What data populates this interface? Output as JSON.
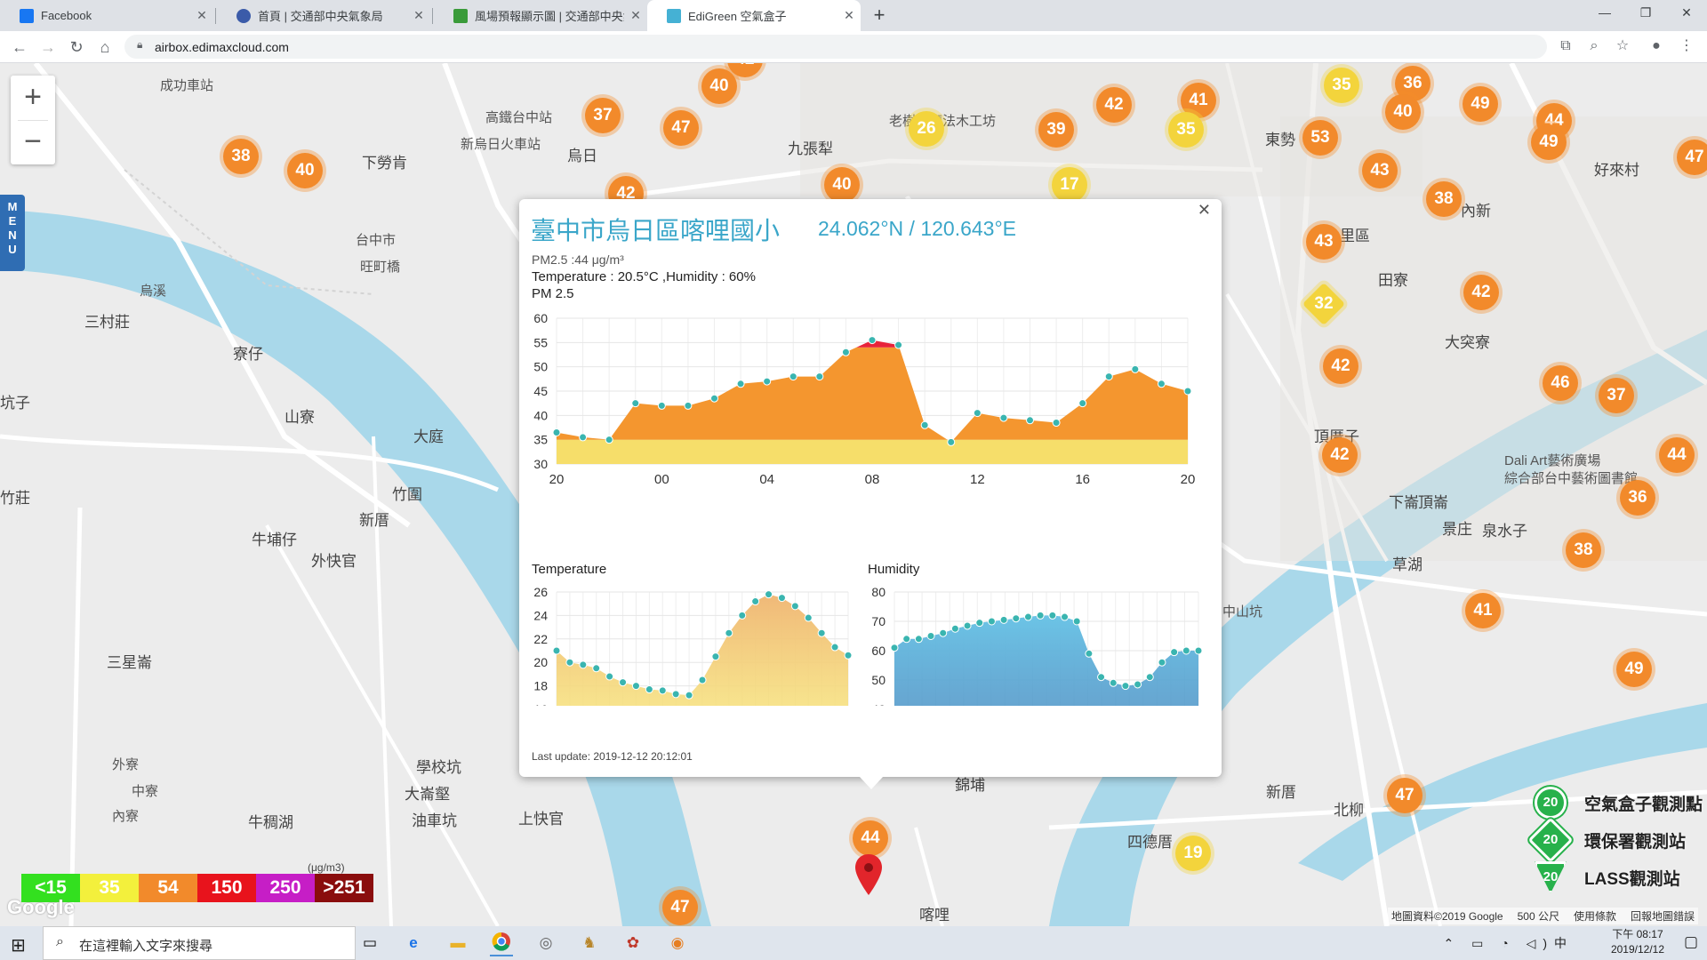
{
  "browser": {
    "tabs": [
      {
        "title": "Facebook",
        "favicon_color": "#1877f2",
        "active": false
      },
      {
        "title": "首頁 | 交通部中央氣象局",
        "favicon_color": "#3b5ba9",
        "active": false
      },
      {
        "title": "風場預報顯示圖 | 交通部中央氣象局",
        "favicon_color": "#3a9b3a",
        "active": false
      },
      {
        "title": "EdiGreen 空氣盒子",
        "favicon_color": "#45b1d4",
        "active": true
      }
    ],
    "new_tab": "+",
    "url": "airbox.edimaxcloud.com",
    "window_controls": [
      "—",
      "❐",
      "✕"
    ]
  },
  "map": {
    "zoom_in": "+",
    "zoom_out": "−",
    "menu_label": [
      "M",
      "E",
      "N",
      "U"
    ],
    "markers": [
      {
        "value": "38",
        "color": "orange"
      },
      {
        "value": "40",
        "color": "orange"
      },
      {
        "value": "37",
        "color": "orange"
      },
      {
        "value": "47",
        "color": "orange"
      },
      {
        "value": "40",
        "color": "orange"
      },
      {
        "value": "42",
        "color": "orange"
      },
      {
        "value": "26",
        "color": "yellow"
      },
      {
        "value": "39",
        "color": "orange"
      },
      {
        "value": "40",
        "color": "orange"
      },
      {
        "value": "42",
        "color": "orange"
      },
      {
        "value": "17",
        "color": "yellow"
      },
      {
        "value": "42",
        "color": "orange"
      },
      {
        "value": "41",
        "color": "orange"
      },
      {
        "value": "35",
        "color": "yellow"
      },
      {
        "value": "35",
        "color": "yellow"
      },
      {
        "value": "36",
        "color": "orange"
      },
      {
        "value": "40",
        "color": "orange"
      },
      {
        "value": "49",
        "color": "orange"
      },
      {
        "value": "44",
        "color": "orange"
      },
      {
        "value": "53",
        "color": "orange"
      },
      {
        "value": "43",
        "color": "orange"
      },
      {
        "value": "49",
        "color": "orange"
      },
      {
        "value": "38",
        "color": "orange"
      },
      {
        "value": "43",
        "color": "orange"
      },
      {
        "value": "32",
        "color": "yellow"
      },
      {
        "value": "42",
        "color": "orange"
      },
      {
        "value": "42",
        "color": "orange"
      },
      {
        "value": "46",
        "color": "orange"
      },
      {
        "value": "37",
        "color": "orange"
      },
      {
        "value": "42",
        "color": "orange"
      },
      {
        "value": "44",
        "color": "orange"
      },
      {
        "value": "36",
        "color": "orange"
      },
      {
        "value": "38",
        "color": "orange"
      },
      {
        "value": "41",
        "color": "orange"
      },
      {
        "value": "49",
        "color": "orange"
      },
      {
        "value": "47",
        "color": "orange"
      },
      {
        "value": "19",
        "color": "yellow"
      },
      {
        "value": "44",
        "color": "orange"
      },
      {
        "value": "47",
        "color": "orange"
      },
      {
        "value": "47",
        "color": "orange"
      }
    ],
    "labels": [
      "成功車站",
      "高鐵台中站",
      "新烏日火車站",
      "烏日",
      "下勞肯",
      "九張犁",
      "老樹根魔法木工坊",
      "台中市",
      "旺町橋",
      "烏溪",
      "三村莊",
      "寮仔",
      "山寮",
      "大庭",
      "竹圍",
      "新厝",
      "牛埔仔",
      "外快官",
      "三星崙",
      "學校坑",
      "大崙壑",
      "油車坑",
      "上快官",
      "牛稠湖",
      "外寮",
      "中寮",
      "內寮",
      "坑子",
      "竹莊",
      "東勢",
      "大里區",
      "田寮",
      "大突寮",
      "頂厝子",
      "頂崙",
      "景庄",
      "泉水子",
      "草湖",
      "內新",
      "好來村",
      "北柳",
      "四德厝",
      "新厝",
      "下崙",
      "喀哩",
      "錦埔",
      "中山坑",
      "Dali Art藝術廣場",
      "綜合部台中藝術圖書館"
    ],
    "legend": [
      {
        "label": "<15",
        "color": "#33e01f"
      },
      {
        "label": "35",
        "color": "#f3f03c"
      },
      {
        "label": "54",
        "color": "#f28a2b"
      },
      {
        "label": "150",
        "color": "#e8131c"
      },
      {
        "label": "250",
        "color": "#c61ec6"
      },
      {
        "label": ">251",
        "color": "#8a0d0d"
      }
    ],
    "legend_unit": "(μg/m3)",
    "google": "Google",
    "station_types": [
      {
        "badge": "20",
        "label": "空氣盒子觀測點"
      },
      {
        "badge": "20",
        "label": "環保署觀測站"
      },
      {
        "badge": "20",
        "label": "LASS觀測站"
      }
    ],
    "attribution": [
      "地圖資料©2019 Google",
      "500 公尺",
      "使用條款",
      "回報地圖錯誤"
    ]
  },
  "popup": {
    "close": "✕",
    "site_name": "臺中市烏日區喀哩國小",
    "coords": "24.062°N / 120.643°E",
    "pm25_line": "PM2.5 :44 μg/m³",
    "temp_hum_line": "Temperature : 20.5°C ,Humidity : 60%",
    "chart_title": "PM 2.5",
    "temp_title": "Temperature",
    "hum_title": "Humidity",
    "last_update": "Last update: 2019-12-12 20:12:01"
  },
  "chart_data": [
    {
      "type": "area",
      "title": "PM 2.5",
      "x_ticks": [
        "20",
        "00",
        "04",
        "08",
        "12",
        "16",
        "20"
      ],
      "ylim": [
        30,
        60
      ],
      "y_ticks": [
        30,
        35,
        40,
        45,
        50,
        55,
        60
      ],
      "series": [
        {
          "values": [
            36.5,
            35.5,
            35,
            42.5,
            42,
            42,
            43.5,
            46.5,
            47,
            48,
            48,
            53,
            55.5,
            54.5,
            38,
            34.5,
            40.5,
            39.5,
            39,
            38.5,
            42.5,
            48,
            49.5,
            46.5,
            45
          ]
        }
      ],
      "colors": {
        "low": "#f6de6a",
        "mid": "#f4962f",
        "high": "#e8233a"
      },
      "grid": true
    },
    {
      "type": "area",
      "title": "Temperature",
      "ylim": [
        16,
        26
      ],
      "y_ticks": [
        16,
        18,
        20,
        22,
        24,
        26
      ],
      "series": [
        {
          "values": [
            21,
            20,
            19.8,
            19.5,
            18.8,
            18.3,
            18,
            17.7,
            17.6,
            17.3,
            17.2,
            18.5,
            20.5,
            22.5,
            24,
            25.2,
            25.8,
            25.5,
            24.8,
            23.8,
            22.5,
            21.3,
            20.6
          ]
        }
      ],
      "colors": {
        "fill": "#f0c070",
        "point": "#3ab5b0"
      },
      "grid": true
    },
    {
      "type": "area",
      "title": "Humidity",
      "ylim": [
        40,
        80
      ],
      "y_ticks": [
        40,
        50,
        60,
        70,
        80
      ],
      "series": [
        {
          "values": [
            61,
            64,
            64,
            65,
            66,
            67.5,
            68.5,
            69.5,
            70,
            70.5,
            71,
            71.5,
            72,
            72,
            71.5,
            70,
            59,
            51,
            49,
            48,
            48.5,
            51,
            56,
            59.5,
            60,
            60
          ]
        }
      ],
      "colors": {
        "fill": "#5eb7de",
        "point": "#3ab5b0"
      },
      "grid": true
    }
  ],
  "taskbar": {
    "search_placeholder": "在這裡輸入文字來搜尋",
    "time": "下午 08:17",
    "date": "2019/12/12",
    "ime": "中"
  }
}
